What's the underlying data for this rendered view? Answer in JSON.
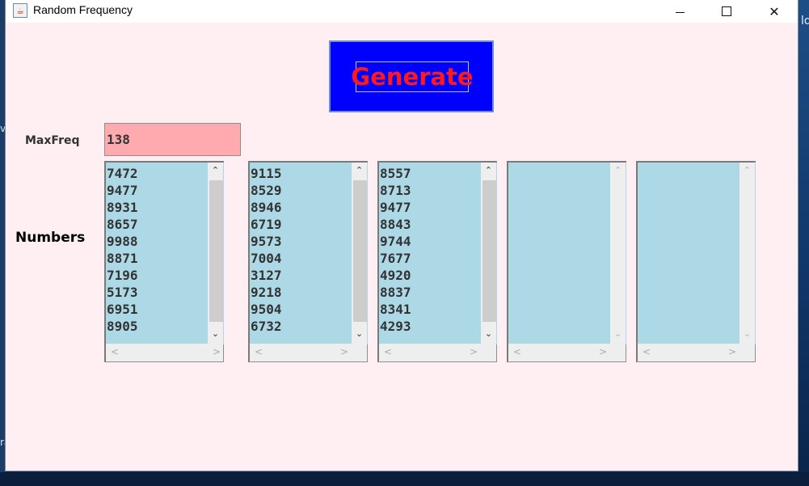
{
  "window": {
    "title": "Random Frequency",
    "app_icon": "java-cup-icon",
    "controls": {
      "minimize": "minimize-icon",
      "maximize": "maximize-icon",
      "close_glyph": "✕"
    }
  },
  "generate_button": {
    "label": "Generate",
    "background": "#0000ff",
    "text_color": "#ff1a1a"
  },
  "maxfreq": {
    "label": "MaxFreq",
    "value": "138",
    "field_color": "#ffaaaf"
  },
  "numbers": {
    "label": "Numbers",
    "list_color": "#add8e6",
    "panes": [
      {
        "items": [
          "7472",
          "9477",
          "8931",
          "8657",
          "9988",
          "8871",
          "7196",
          "5173",
          "6951",
          "8905"
        ]
      },
      {
        "items": [
          "9115",
          "8529",
          "8946",
          "6719",
          "9573",
          "7004",
          "3127",
          "9218",
          "9504",
          "6732"
        ]
      },
      {
        "items": [
          "8557",
          "8713",
          "9477",
          "8843",
          "9744",
          "7677",
          "4920",
          "8837",
          "8341",
          "4293"
        ]
      },
      {
        "items": []
      },
      {
        "items": []
      }
    ]
  },
  "desktop": {
    "right_edge_text": "ld",
    "left_edge_text_1": "v",
    "left_edge_text_2": "ra"
  }
}
